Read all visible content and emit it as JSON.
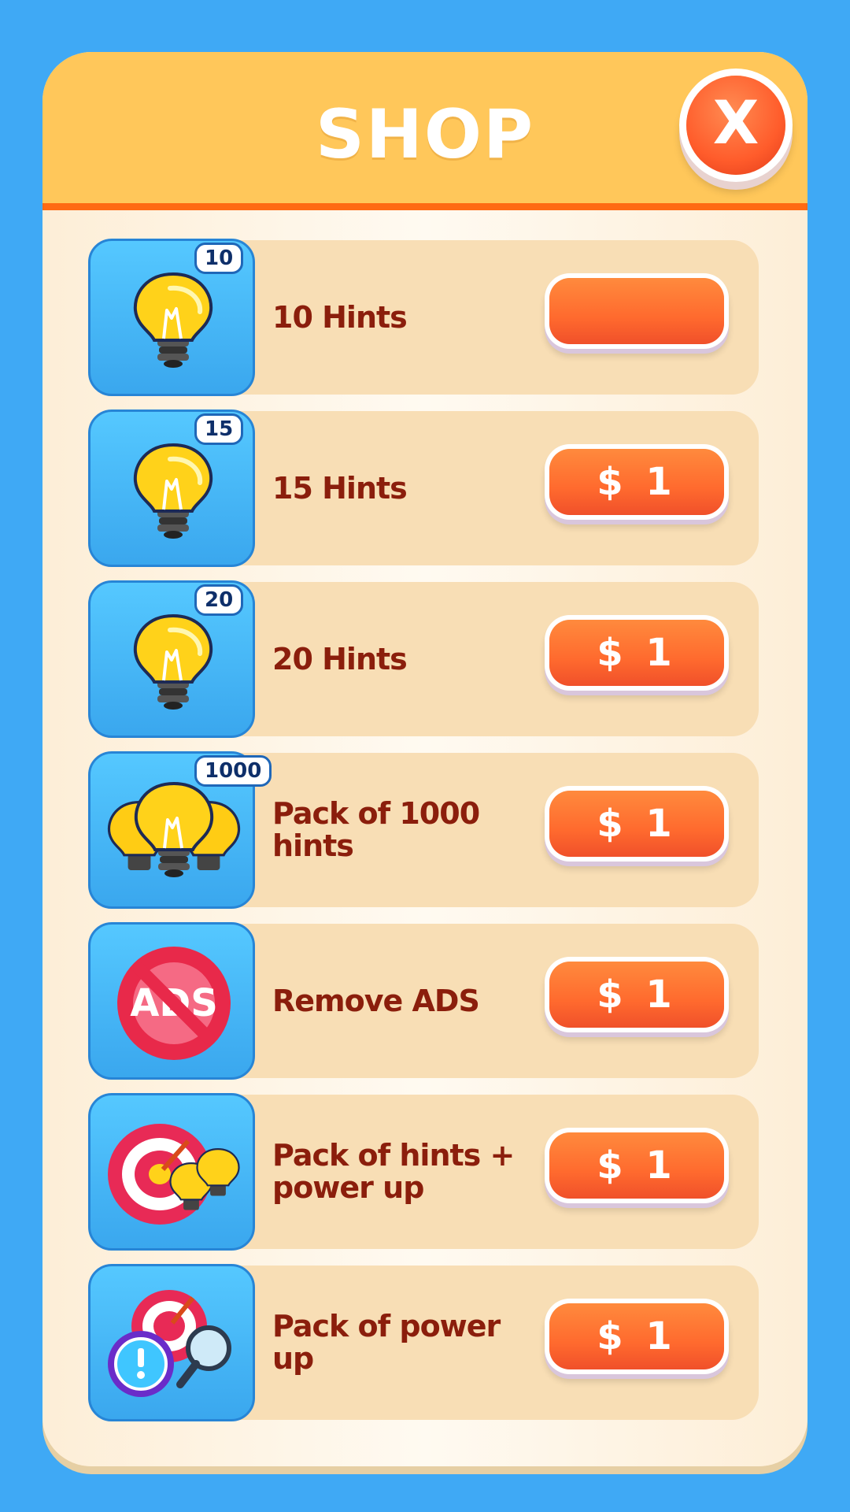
{
  "header": {
    "title": "SHOP",
    "close_label": "X"
  },
  "colors": {
    "background": "#3fa9f5",
    "header": "#ffc75a",
    "header_rule": "#ff6a13",
    "row": "#f8deb5",
    "label_text": "#8b1e0c",
    "button": "#ff6a2e"
  },
  "items": [
    {
      "label": "10 Hints",
      "badge": "10",
      "price": "",
      "icon": "lightbulb-icon"
    },
    {
      "label": "15 Hints",
      "badge": "15",
      "price": "$ 1",
      "icon": "lightbulb-icon"
    },
    {
      "label": "20 Hints",
      "badge": "20",
      "price": "$ 1",
      "icon": "lightbulb-icon"
    },
    {
      "label": "Pack of 1000 hints",
      "badge": "1000",
      "price": "$ 1",
      "icon": "lightbulb-bundle-icon"
    },
    {
      "label": "Remove ADS",
      "badge": "",
      "price": "$ 1",
      "icon": "no-ads-icon"
    },
    {
      "label": "Pack of hints + power up",
      "badge": "",
      "price": "$ 1",
      "icon": "target-and-bulbs-icon"
    },
    {
      "label": "Pack of power up",
      "badge": "",
      "price": "$ 1",
      "icon": "powerup-bundle-icon"
    }
  ],
  "ads_icon_text": "ADS"
}
